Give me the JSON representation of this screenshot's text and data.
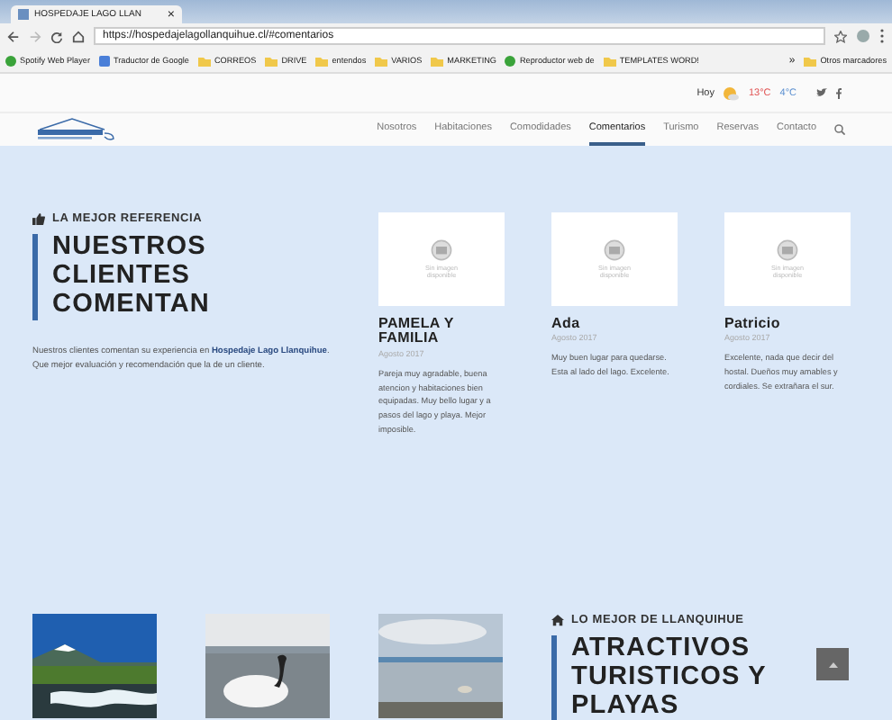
{
  "browser": {
    "tab": {
      "title": "HOSPEDAJE LAGO LLAN",
      "close": "×"
    },
    "address": "https://hospedajelagollanquihue.cl/#comentarios",
    "bookmarks": [
      {
        "label": "Spotify Web Player",
        "kind": "app"
      },
      {
        "label": "Traductor de Google",
        "kind": "translate"
      },
      {
        "label": "CORREOS",
        "kind": "folder"
      },
      {
        "label": "DRIVE",
        "kind": "folder"
      },
      {
        "label": "entendos",
        "kind": "folder"
      },
      {
        "label": "VARIOS",
        "kind": "folder"
      },
      {
        "label": "MARKETING",
        "kind": "folder"
      },
      {
        "label": "Reproductor web de",
        "kind": "app"
      },
      {
        "label": "TEMPLATES WORD!",
        "kind": "folder"
      }
    ],
    "more": "»",
    "other_bookmarks": "Otros marcadores"
  },
  "topbar": {
    "day": "Hoy",
    "high": "13°C",
    "low": "4°C"
  },
  "nav": [
    {
      "label": "Nosotros",
      "selected": false
    },
    {
      "label": "Habitaciones",
      "selected": false
    },
    {
      "label": "Comodidades",
      "selected": false
    },
    {
      "label": "Comentarios",
      "selected": true
    },
    {
      "label": "Turismo",
      "selected": false
    },
    {
      "label": "Reservas",
      "selected": false
    },
    {
      "label": "Contacto",
      "selected": false
    }
  ],
  "reviews_section": {
    "eyebrow": "LA MEJOR REFERENCIA",
    "heading": "NUESTROS CLIENTES COMENTAN",
    "intro": "Nuestros clientes comentan su experiencia en **Hospedaje Lago Llanquihue**. Que mejor evaluación y recomendación que la de un cliente."
  },
  "reviews": [
    {
      "image_note": "Sin imagen disponible",
      "name": "PAMELA Y FAMILIA",
      "date": "Agosto 2017",
      "text": "Pareja muy agradable, buena atencion y habitaciones bien equipadas. Muy bello lugar y a pasos del lago y playa. Mejor imposible."
    },
    {
      "image_note": "Sin imagen disponible",
      "name": "Ada",
      "date": "Agosto 2017",
      "text": "Muy buen lugar para quedarse. Esta al lado del lago. Excelente."
    },
    {
      "image_note": "Sin imagen disponible",
      "name": "Patricio",
      "date": "Agosto 2017",
      "text": "Excelente, nada que decir del hostal. Dueños muy amables y cordiales. Se extrañara el sur."
    }
  ],
  "tourism_section": {
    "eyebrow": "LO MEJOR DE LLANQUIHUE",
    "heading": "ATRACTIVOS TURISTICOS Y PLAYAS"
  }
}
